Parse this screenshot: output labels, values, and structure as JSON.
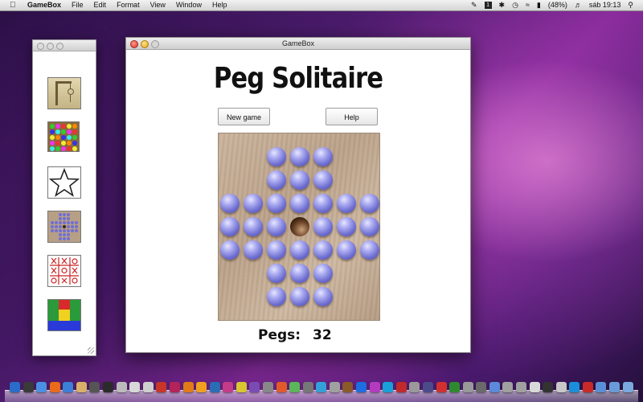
{
  "menubar": {
    "apple": "",
    "app_name": "GameBox",
    "menus": [
      "File",
      "Edit",
      "Format",
      "View",
      "Window",
      "Help"
    ],
    "status": {
      "input_box": "1",
      "battery": "(48%)",
      "clock": "sáb 19:13"
    }
  },
  "main_window": {
    "title": "GameBox",
    "game_title": "Peg Solitaire",
    "new_game_label": "New game",
    "help_label": "Help",
    "pegs_label": "Pegs:",
    "pegs_count": "32"
  },
  "board": {
    "layout": [
      "  OOO  ",
      "  OOO  ",
      "OOOOOOO",
      "OOO.OOO",
      "OOOOOOO",
      "  OOO  ",
      "  OOO  "
    ]
  },
  "palette": {
    "games": [
      "hangman-icon",
      "jewels-icon",
      "star-icon",
      "peg-solitaire-icon",
      "tic-tac-toe-icon",
      "blocks-icon"
    ]
  },
  "colors": {
    "peg": "#7a7ad8",
    "board": "#c2aa92",
    "dock_icons": [
      "#2a6cc9",
      "#3a3a3a",
      "#4a90e2",
      "#e86a1a",
      "#3b7fd6",
      "#d9b06a",
      "#555",
      "#2b2b2b",
      "#bbb",
      "#d8d8d8",
      "#cfcfcf",
      "#c8362a",
      "#b3245a",
      "#e07b17",
      "#f0a020",
      "#2a6db3",
      "#c43b87",
      "#d9c531",
      "#7a4bb3",
      "#888",
      "#e15a2a",
      "#5bb65a",
      "#777",
      "#33a0d8",
      "#a0a0a0",
      "#8a5a2a",
      "#1d6ee0",
      "#b23bbf",
      "#1aa0d8",
      "#c02a2a",
      "#9a9a9a",
      "#4b4b8a",
      "#d03030",
      "#2f8a2f",
      "#999",
      "#6a6a6a",
      "#5a8ad8",
      "#a0a0a0",
      "#a0a0a0",
      "#d8d8d8",
      "#333",
      "#c8c8c8",
      "#1a8ed8",
      "#c82a2a",
      "#5a8fd8",
      "#6a9ad8",
      "#7aa8de"
    ]
  }
}
